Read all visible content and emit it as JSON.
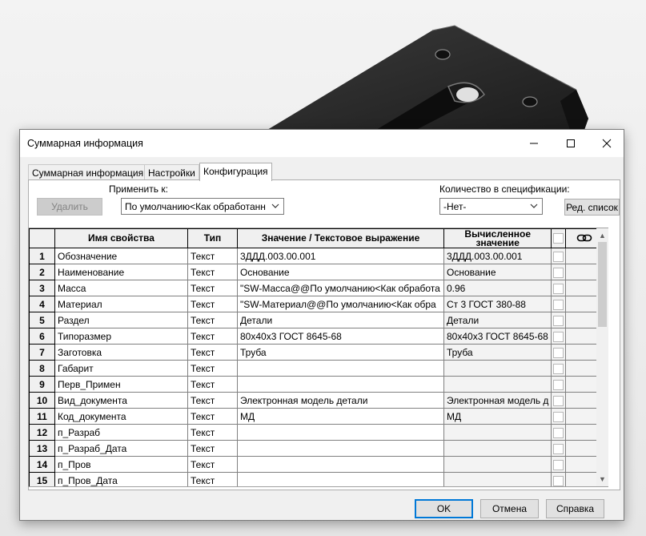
{
  "window": {
    "title": "Суммарная информация",
    "minimize_icon": "minimize-icon",
    "maximize_icon": "maximize-icon",
    "close_icon": "close-icon"
  },
  "tabs": [
    {
      "label": "Суммарная информация",
      "active": false
    },
    {
      "label": "Настройки",
      "active": false
    },
    {
      "label": "Конфигурация",
      "active": true
    }
  ],
  "toolbar": {
    "delete_label": "Удалить",
    "apply_to_label": "Применить к:",
    "apply_to_value": "По умолчанию<Как обработанн",
    "qty_label": "Количество в спецификации:",
    "qty_value": "-Нет-",
    "edit_list_label": "Ред. список"
  },
  "grid": {
    "columns": [
      "Имя свойства",
      "Тип",
      "Значение / Текстовое выражение",
      "Вычисленное значение"
    ],
    "link_icon": "link-icon",
    "rows": [
      {
        "n": "1",
        "name": "Обозначение",
        "type": "Текст",
        "value": "3ДДД.003.00.001",
        "calc": "3ДДД.003.00.001"
      },
      {
        "n": "2",
        "name": "Наименование",
        "type": "Текст",
        "value": "Основание",
        "calc": "Основание"
      },
      {
        "n": "3",
        "name": "Масса",
        "type": "Текст",
        "value": "\"SW-Масса@@По умолчанию<Как обработа",
        "calc": "0.96"
      },
      {
        "n": "4",
        "name": "Материал",
        "type": "Текст",
        "value": "\"SW-Материал@@По умолчанию<Как обра",
        "calc": "Ст 3 ГОСТ 380-88"
      },
      {
        "n": "5",
        "name": "Раздел",
        "type": "Текст",
        "value": "Детали",
        "calc": "Детали"
      },
      {
        "n": "6",
        "name": "Типоразмер",
        "type": "Текст",
        "value": "80x40x3 ГОСТ 8645-68",
        "calc": "80x40x3 ГОСТ 8645-68"
      },
      {
        "n": "7",
        "name": "Заготовка",
        "type": "Текст",
        "value": "Труба",
        "calc": "Труба"
      },
      {
        "n": "8",
        "name": "Габарит",
        "type": "Текст",
        "value": "",
        "calc": ""
      },
      {
        "n": "9",
        "name": "Перв_Примен",
        "type": "Текст",
        "value": "",
        "calc": ""
      },
      {
        "n": "10",
        "name": "Вид_документа",
        "type": "Текст",
        "value": "Электронная модель детали",
        "calc": "Электронная модель д"
      },
      {
        "n": "11",
        "name": "Код_документа",
        "type": "Текст",
        "value": "МД",
        "calc": "МД"
      },
      {
        "n": "12",
        "name": "п_Разраб",
        "type": "Текст",
        "value": "",
        "calc": ""
      },
      {
        "n": "13",
        "name": "п_Разраб_Дата",
        "type": "Текст",
        "value": "",
        "calc": ""
      },
      {
        "n": "14",
        "name": "п_Пров",
        "type": "Текст",
        "value": "",
        "calc": ""
      },
      {
        "n": "15",
        "name": "п_Пров_Дата",
        "type": "Текст",
        "value": "",
        "calc": ""
      }
    ]
  },
  "footer": {
    "ok_label": "OK",
    "cancel_label": "Отмена",
    "help_label": "Справка"
  },
  "colors": {
    "accent": "#0078d7",
    "dialog_bg": "#f0f0f0",
    "part_color": "#2e2e2e"
  }
}
